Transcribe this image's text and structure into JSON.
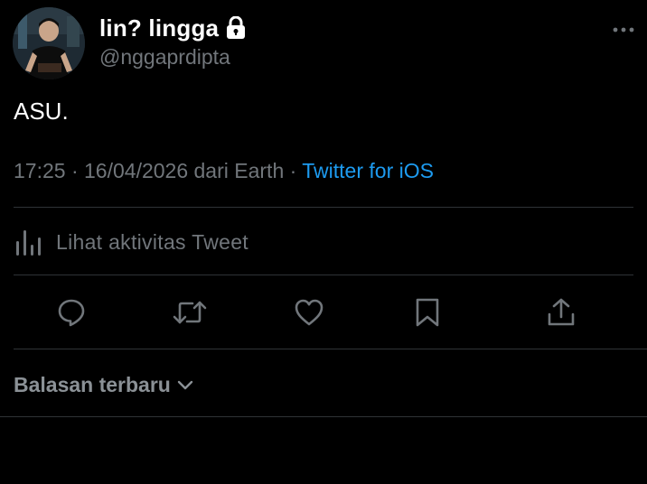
{
  "profile": {
    "display_name": "lin? lingga",
    "handle": "@nggaprdipta",
    "avatar_icon": "user-avatar-photo",
    "protected_icon": "lock-icon"
  },
  "tweet": {
    "text": "ASU."
  },
  "meta": {
    "time": "17:25",
    "separator1": " · ",
    "date_location": "16/04/2026 dari Earth",
    "separator2": " · ",
    "client": "Twitter for iOS"
  },
  "activity": {
    "label": "Lihat aktivitas Tweet",
    "icon": "analytics-bar-icon"
  },
  "actions": [
    {
      "name": "reply",
      "icon": "reply-icon"
    },
    {
      "name": "retweet",
      "icon": "retweet-icon"
    },
    {
      "name": "like",
      "icon": "heart-icon"
    },
    {
      "name": "bookmark",
      "icon": "bookmark-icon"
    },
    {
      "name": "share",
      "icon": "share-icon"
    }
  ],
  "replies": {
    "sort_label": "Balasan terbaru",
    "chevron_icon": "chevron-down-icon"
  },
  "colors": {
    "background": "#000000",
    "text_primary": "#ffffff",
    "text_secondary": "#71767b",
    "link_blue": "#1d9bf0",
    "divider": "#2f3336"
  }
}
